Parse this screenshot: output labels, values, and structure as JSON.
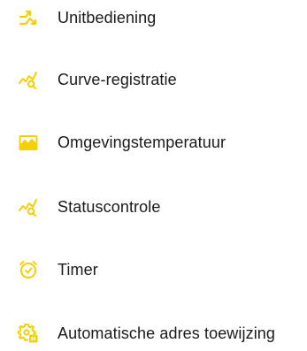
{
  "accent_color": "#f5d000",
  "menu": {
    "items": [
      {
        "label": "Unitbediening",
        "icon": "unit-control-arrows-icon"
      },
      {
        "label": "Curve-registratie",
        "icon": "curve-search-icon"
      },
      {
        "label": "Omgevingstemperatuur",
        "icon": "ambient-temperature-landscape-icon"
      },
      {
        "label": "Statuscontrole",
        "icon": "status-check-search-icon"
      },
      {
        "label": "Timer",
        "icon": "alarm-clock-timer-icon"
      },
      {
        "label": "Automatische adres toewijzing",
        "icon": "auto-address-gear-icon"
      }
    ]
  }
}
